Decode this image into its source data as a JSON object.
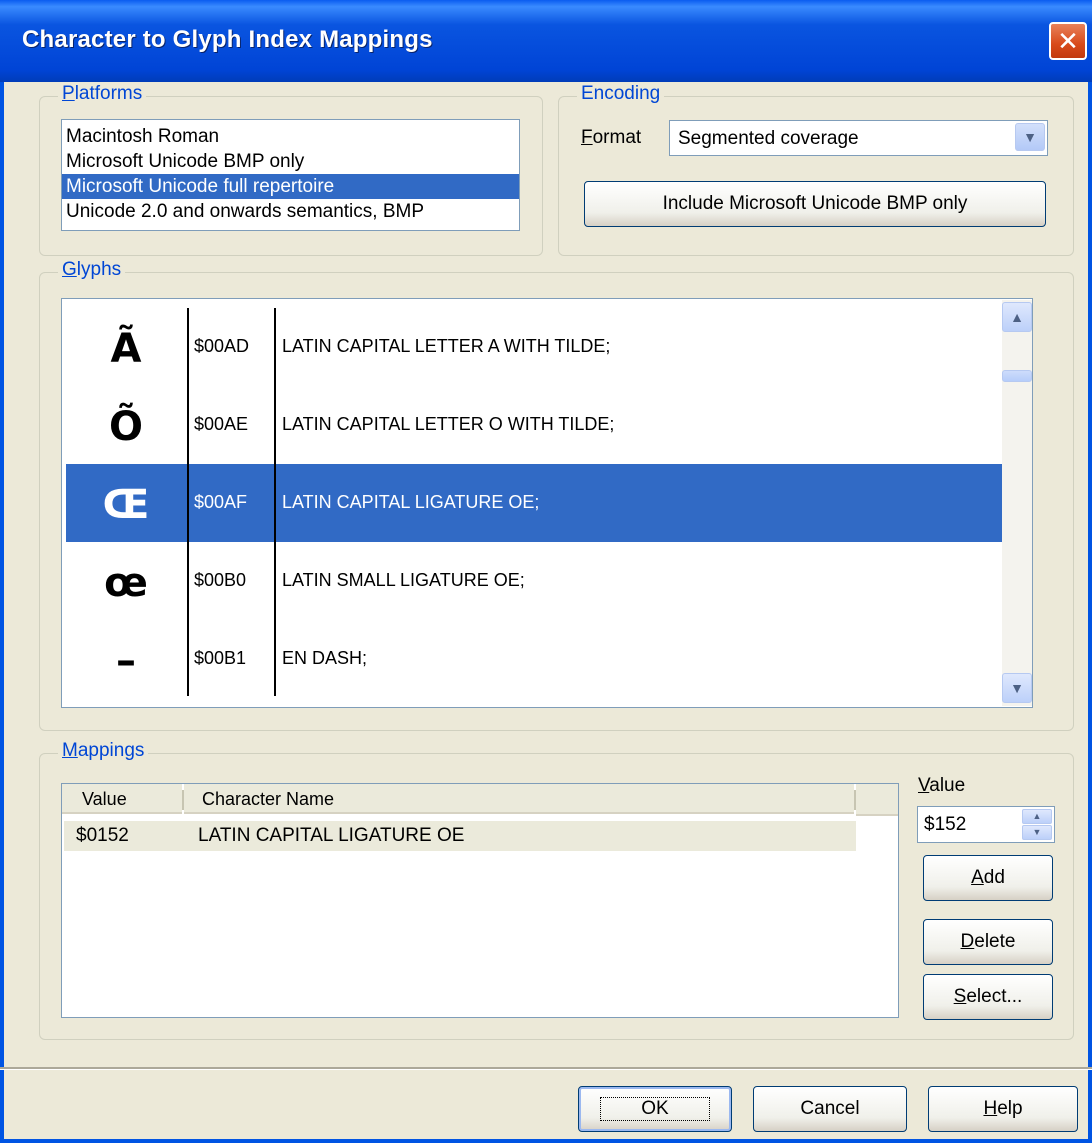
{
  "window": {
    "title": "Character to Glyph Index Mappings"
  },
  "platforms": {
    "legend_letter": "P",
    "legend_rest": "latforms",
    "items": [
      "Macintosh Roman",
      "Microsoft Unicode BMP only",
      "Microsoft Unicode full repertoire",
      "Unicode 2.0 and onwards semantics, BMP"
    ],
    "selected_index": 2
  },
  "encoding": {
    "legend": "Encoding",
    "format_letter": "F",
    "format_rest": "ormat",
    "format_value": "Segmented coverage",
    "include_button": "Include Microsoft Unicode BMP only"
  },
  "glyphs": {
    "legend_letter": "G",
    "legend_rest": "lyphs",
    "rows": [
      {
        "glyph": "Ã",
        "code": "$00AD",
        "name": "LATIN CAPITAL LETTER A WITH TILDE;"
      },
      {
        "glyph": "Õ",
        "code": "$00AE",
        "name": "LATIN CAPITAL LETTER O WITH TILDE;"
      },
      {
        "glyph": "Œ",
        "code": "$00AF",
        "name": "LATIN CAPITAL LIGATURE OE;"
      },
      {
        "glyph": "œ",
        "code": "$00B0",
        "name": "LATIN SMALL LIGATURE OE;"
      },
      {
        "glyph": "–",
        "code": "$00B1",
        "name": "EN DASH;"
      }
    ],
    "selected_index": 2
  },
  "mappings": {
    "legend_letter": "M",
    "legend_rest": "appings",
    "columns": [
      "Value",
      "Character Name"
    ],
    "rows": [
      {
        "value": "$0152",
        "name": "LATIN CAPITAL LIGATURE OE"
      }
    ],
    "value_label_letter": "V",
    "value_label_rest": "alue",
    "value_field": "$152",
    "add_letter": "A",
    "add_rest": "dd",
    "delete_letter": "D",
    "delete_rest": "elete",
    "select_letter": "S",
    "select_rest": "elect..."
  },
  "footer": {
    "ok": "OK",
    "cancel": "Cancel",
    "help_letter": "H",
    "help_rest": "elp"
  }
}
